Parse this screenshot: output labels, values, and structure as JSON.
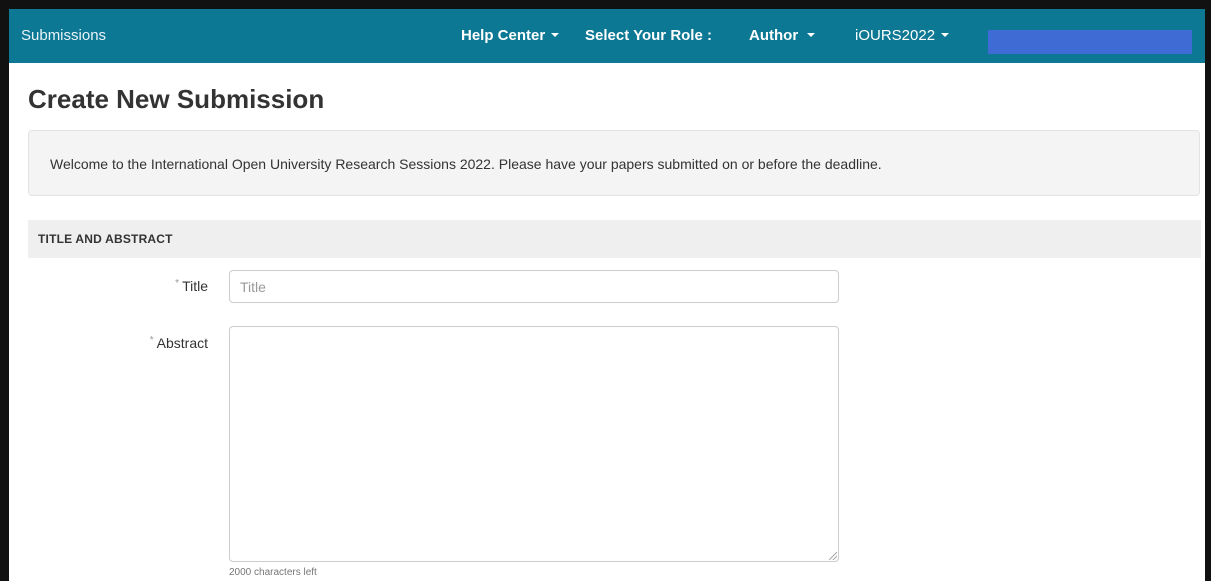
{
  "navbar": {
    "brand": "Submissions",
    "help_center": "Help Center",
    "select_role_label": "Select Your Role :",
    "role": "Author",
    "conference": "iOURS2022",
    "background_color": "#0d7894",
    "user_box_color": "#3f6bd4"
  },
  "page": {
    "title": "Create New Submission",
    "welcome_message": "Welcome to the International Open University Research Sessions 2022. Please have your papers submitted on or before the deadline."
  },
  "section": {
    "header": "TITLE AND ABSTRACT"
  },
  "form": {
    "required_marker": "*",
    "title_label": "Title",
    "title_placeholder": "Title",
    "title_value": "",
    "abstract_label": "Abstract",
    "abstract_value": "",
    "abstract_chars_left": "2000 characters left"
  }
}
